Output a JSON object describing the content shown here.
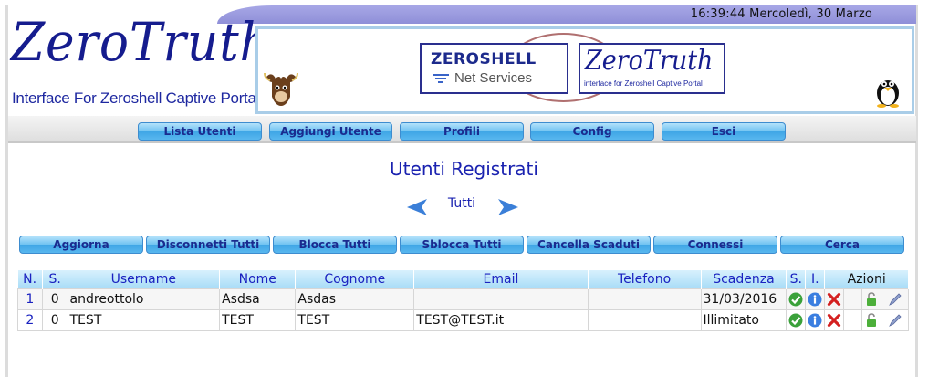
{
  "header": {
    "clock": "16:39:44 Mercoledì, 30 Marzo",
    "logo_title": "ZeroTruth",
    "logo_subtitle": "Interface For Zeroshell Captive Portal"
  },
  "banner": {
    "zeroshell_title": "ZEROSHELL",
    "zeroshell_subtitle": "Net Services",
    "zerotruth_title": "ZeroTruth",
    "zerotruth_subtitle": "interface for Zeroshell Captive Portal"
  },
  "nav": [
    {
      "label": "Lista Utenti"
    },
    {
      "label": "Aggiungi Utente"
    },
    {
      "label": "Profili"
    },
    {
      "label": "Config"
    },
    {
      "label": "Esci"
    }
  ],
  "page": {
    "title": "Utenti Registrati",
    "filter": "Tutti"
  },
  "actions": [
    {
      "label": "Aggiorna"
    },
    {
      "label": "Disconnetti Tutti"
    },
    {
      "label": "Blocca Tutti"
    },
    {
      "label": "Sblocca Tutti"
    },
    {
      "label": "Cancella Scaduti"
    },
    {
      "label": "Connessi"
    },
    {
      "label": "Cerca"
    }
  ],
  "table": {
    "headers": [
      "N.",
      "S.",
      "Username",
      "Nome",
      "Cognome",
      "Email",
      "Telefono",
      "Scadenza",
      "S.",
      "I.",
      "Azioni"
    ],
    "rows": [
      {
        "n": "1",
        "s": "0",
        "username": "andreottolo",
        "nome": "Asdsa",
        "cognome": "Asdas",
        "email": "",
        "telefono": "",
        "scadenza": "31/03/2016"
      },
      {
        "n": "2",
        "s": "0",
        "username": "TEST",
        "nome": "TEST",
        "cognome": "TEST",
        "email": "TEST@TEST.it",
        "telefono": "",
        "scadenza": "Illimitato"
      }
    ]
  },
  "colors": {
    "accent": "#1a22b0",
    "button_top": "#b4e2fb",
    "button_bottom": "#3fa6e6",
    "topbar": "#9a9ade",
    "status_ok": "#3aa13a",
    "delete": "#d42020"
  },
  "icons": [
    "gnu-icon",
    "tux-icon",
    "arrow-left-icon",
    "arrow-right-icon",
    "check-icon",
    "info-icon",
    "delete-icon",
    "unlock-icon",
    "edit-icon"
  ]
}
